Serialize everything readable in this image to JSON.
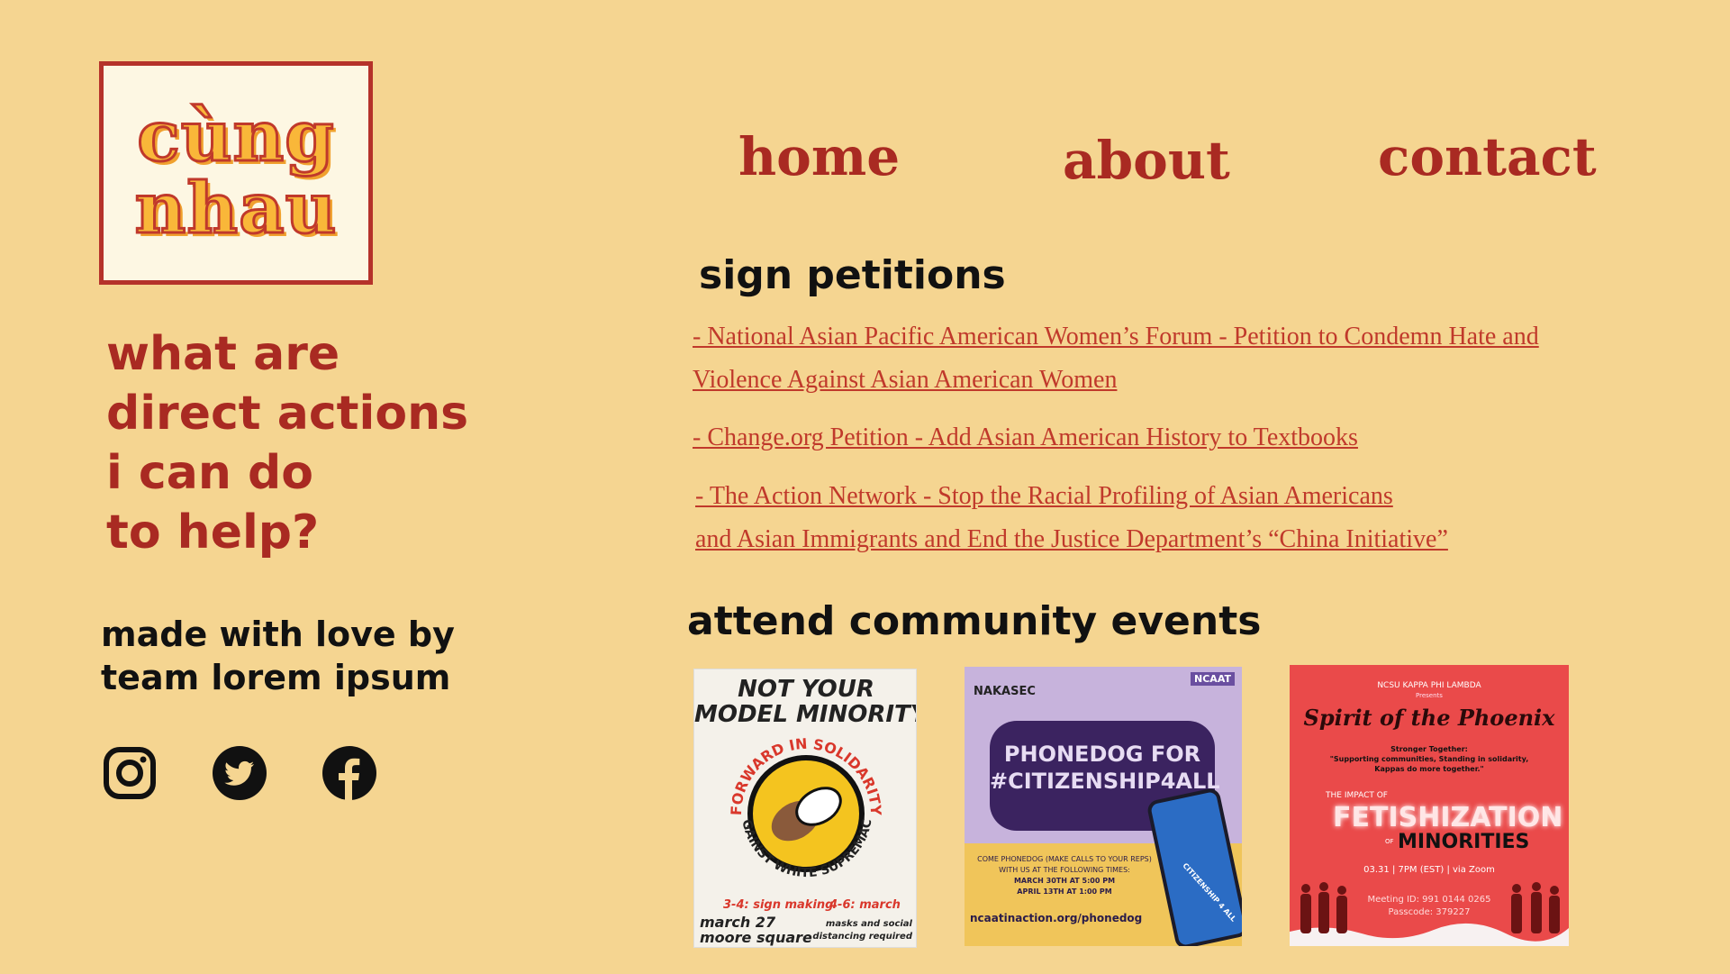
{
  "logo": {
    "line1": "cùng",
    "line2": "nhau"
  },
  "question": {
    "lines": [
      "what are",
      "direct actions",
      "i can do",
      "to help?"
    ]
  },
  "credit": {
    "line1": "made with love by",
    "line2": "team lorem ipsum"
  },
  "social": [
    "instagram-icon",
    "twitter-icon",
    "facebook-icon"
  ],
  "nav": {
    "home": "home",
    "about": "about",
    "contact": "contact"
  },
  "petitions": {
    "title": "sign petitions",
    "items": [
      {
        "line1": "- National Asian Pacific American Women’s Forum - Petition to Condemn Hate and ",
        "line2": "Violence Against Asian American Women"
      },
      {
        "line1": "- Change.org Petition - Add Asian American History to Textbooks "
      },
      {
        "line1": "- The Action Network - Stop the Racial Profiling of Asian Americans ",
        "line2": "and Asian Immigrants and End the Justice Department’s “China Initiative” "
      }
    ]
  },
  "events": {
    "title": "attend community events",
    "poster1": {
      "head1": "NOT YOUR",
      "head2": "MODEL MINORITY",
      "ring_top": "FORWARD IN SOLIDARITY",
      "ring_bottom": "AGAINST WHITE SUPREMACY",
      "sched1": "3-4: sign making",
      "sched2": "4-6: march",
      "date": "march 27",
      "place": "moore square",
      "note1": "masks and social",
      "note2": "distancing required"
    },
    "poster2": {
      "org": "NAKASEC",
      "badge": "NCAAT",
      "head1": "PHONEDOG FOR",
      "head2": "#CITIZENSHIP4ALL",
      "body1": "COME PHONEDOG (MAKE CALLS TO YOUR REPS)",
      "body2": "WITH US AT THE FOLLOWING TIMES:",
      "time1": "MARCH 30TH AT 5:00 PM",
      "time2": "APRIL 13TH AT 1:00 PM",
      "url": "ncaatinaction.org/phonedog",
      "phone_text": "CITIZENSHIP 4 ALL"
    },
    "poster3": {
      "org": "NCSU KAPPA PHI LAMBDA",
      "presents": "Presents",
      "title": "Spirit of the Phoenix",
      "sub1": "Stronger Together:",
      "sub2": "\"Supporting communities, Standing in solidarity,",
      "sub3": "Kappas do more together.\"",
      "impact": "THE IMPACT OF",
      "big": "FETISHIZATION",
      "of": "OF",
      "minorities": "MINORITIES",
      "when": "03.31 | 7PM (EST) | via Zoom",
      "meeting": "Meeting ID: 991 0144 0265",
      "pass": "Passcode: 379227"
    }
  },
  "colors": {
    "background": "#f5d591",
    "accent": "#a92a22",
    "link": "#c0392b",
    "logo_fill": "#f9b739"
  }
}
